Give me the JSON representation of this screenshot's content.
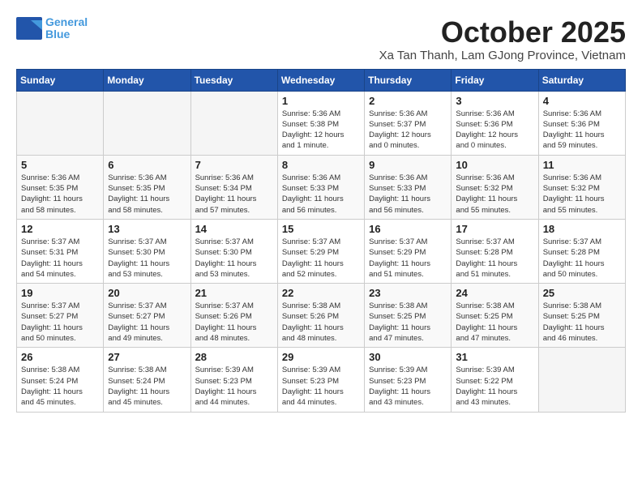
{
  "logo": {
    "line1": "General",
    "line2": "Blue"
  },
  "header": {
    "month_title": "October 2025",
    "subtitle": "Xa Tan Thanh, Lam GJong Province, Vietnam"
  },
  "weekdays": [
    "Sunday",
    "Monday",
    "Tuesday",
    "Wednesday",
    "Thursday",
    "Friday",
    "Saturday"
  ],
  "weeks": [
    [
      {
        "day": "",
        "info": ""
      },
      {
        "day": "",
        "info": ""
      },
      {
        "day": "",
        "info": ""
      },
      {
        "day": "1",
        "info": "Sunrise: 5:36 AM\nSunset: 5:38 PM\nDaylight: 12 hours\nand 1 minute."
      },
      {
        "day": "2",
        "info": "Sunrise: 5:36 AM\nSunset: 5:37 PM\nDaylight: 12 hours\nand 0 minutes."
      },
      {
        "day": "3",
        "info": "Sunrise: 5:36 AM\nSunset: 5:36 PM\nDaylight: 12 hours\nand 0 minutes."
      },
      {
        "day": "4",
        "info": "Sunrise: 5:36 AM\nSunset: 5:36 PM\nDaylight: 11 hours\nand 59 minutes."
      }
    ],
    [
      {
        "day": "5",
        "info": "Sunrise: 5:36 AM\nSunset: 5:35 PM\nDaylight: 11 hours\nand 58 minutes."
      },
      {
        "day": "6",
        "info": "Sunrise: 5:36 AM\nSunset: 5:35 PM\nDaylight: 11 hours\nand 58 minutes."
      },
      {
        "day": "7",
        "info": "Sunrise: 5:36 AM\nSunset: 5:34 PM\nDaylight: 11 hours\nand 57 minutes."
      },
      {
        "day": "8",
        "info": "Sunrise: 5:36 AM\nSunset: 5:33 PM\nDaylight: 11 hours\nand 56 minutes."
      },
      {
        "day": "9",
        "info": "Sunrise: 5:36 AM\nSunset: 5:33 PM\nDaylight: 11 hours\nand 56 minutes."
      },
      {
        "day": "10",
        "info": "Sunrise: 5:36 AM\nSunset: 5:32 PM\nDaylight: 11 hours\nand 55 minutes."
      },
      {
        "day": "11",
        "info": "Sunrise: 5:36 AM\nSunset: 5:32 PM\nDaylight: 11 hours\nand 55 minutes."
      }
    ],
    [
      {
        "day": "12",
        "info": "Sunrise: 5:37 AM\nSunset: 5:31 PM\nDaylight: 11 hours\nand 54 minutes."
      },
      {
        "day": "13",
        "info": "Sunrise: 5:37 AM\nSunset: 5:30 PM\nDaylight: 11 hours\nand 53 minutes."
      },
      {
        "day": "14",
        "info": "Sunrise: 5:37 AM\nSunset: 5:30 PM\nDaylight: 11 hours\nand 53 minutes."
      },
      {
        "day": "15",
        "info": "Sunrise: 5:37 AM\nSunset: 5:29 PM\nDaylight: 11 hours\nand 52 minutes."
      },
      {
        "day": "16",
        "info": "Sunrise: 5:37 AM\nSunset: 5:29 PM\nDaylight: 11 hours\nand 51 minutes."
      },
      {
        "day": "17",
        "info": "Sunrise: 5:37 AM\nSunset: 5:28 PM\nDaylight: 11 hours\nand 51 minutes."
      },
      {
        "day": "18",
        "info": "Sunrise: 5:37 AM\nSunset: 5:28 PM\nDaylight: 11 hours\nand 50 minutes."
      }
    ],
    [
      {
        "day": "19",
        "info": "Sunrise: 5:37 AM\nSunset: 5:27 PM\nDaylight: 11 hours\nand 50 minutes."
      },
      {
        "day": "20",
        "info": "Sunrise: 5:37 AM\nSunset: 5:27 PM\nDaylight: 11 hours\nand 49 minutes."
      },
      {
        "day": "21",
        "info": "Sunrise: 5:37 AM\nSunset: 5:26 PM\nDaylight: 11 hours\nand 48 minutes."
      },
      {
        "day": "22",
        "info": "Sunrise: 5:38 AM\nSunset: 5:26 PM\nDaylight: 11 hours\nand 48 minutes."
      },
      {
        "day": "23",
        "info": "Sunrise: 5:38 AM\nSunset: 5:25 PM\nDaylight: 11 hours\nand 47 minutes."
      },
      {
        "day": "24",
        "info": "Sunrise: 5:38 AM\nSunset: 5:25 PM\nDaylight: 11 hours\nand 47 minutes."
      },
      {
        "day": "25",
        "info": "Sunrise: 5:38 AM\nSunset: 5:25 PM\nDaylight: 11 hours\nand 46 minutes."
      }
    ],
    [
      {
        "day": "26",
        "info": "Sunrise: 5:38 AM\nSunset: 5:24 PM\nDaylight: 11 hours\nand 45 minutes."
      },
      {
        "day": "27",
        "info": "Sunrise: 5:38 AM\nSunset: 5:24 PM\nDaylight: 11 hours\nand 45 minutes."
      },
      {
        "day": "28",
        "info": "Sunrise: 5:39 AM\nSunset: 5:23 PM\nDaylight: 11 hours\nand 44 minutes."
      },
      {
        "day": "29",
        "info": "Sunrise: 5:39 AM\nSunset: 5:23 PM\nDaylight: 11 hours\nand 44 minutes."
      },
      {
        "day": "30",
        "info": "Sunrise: 5:39 AM\nSunset: 5:23 PM\nDaylight: 11 hours\nand 43 minutes."
      },
      {
        "day": "31",
        "info": "Sunrise: 5:39 AM\nSunset: 5:22 PM\nDaylight: 11 hours\nand 43 minutes."
      },
      {
        "day": "",
        "info": ""
      }
    ]
  ]
}
